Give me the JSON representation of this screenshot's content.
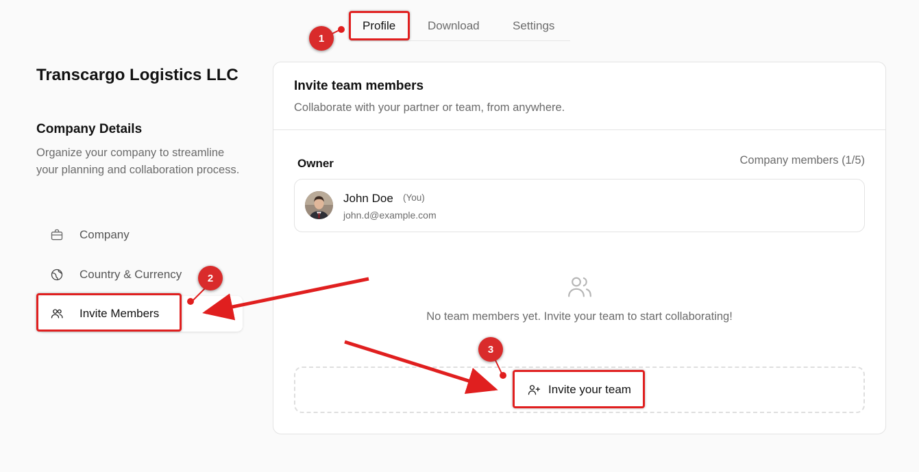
{
  "tabs": [
    {
      "label": "Profile",
      "active": true
    },
    {
      "label": "Download",
      "active": false
    },
    {
      "label": "Settings",
      "active": false
    }
  ],
  "sidebar": {
    "company_name": "Transcargo Logistics LLC",
    "section_title": "Company Details",
    "section_desc": "Organize your company to streamline your planning and collaboration process.",
    "items": [
      {
        "label": "Company",
        "icon": "briefcase-icon",
        "active": false
      },
      {
        "label": "Country & Currency",
        "icon": "globe-icon",
        "active": false
      },
      {
        "label": "Invite Members",
        "icon": "users-icon",
        "active": true
      }
    ]
  },
  "card": {
    "title": "Invite team members",
    "subtitle": "Collaborate with your partner or team, from anywhere.",
    "owner_label": "Owner",
    "members_count": "Company members (1/5)",
    "owner": {
      "name": "John Doe",
      "you_tag": "(You)",
      "email": "john.d@example.com"
    },
    "empty_text": "No team members yet. Invite your team to start collaborating!",
    "invite_button": "Invite your team"
  },
  "annotations": {
    "step1": "1",
    "step2": "2",
    "step3": "3",
    "color": "#e01f1f"
  }
}
